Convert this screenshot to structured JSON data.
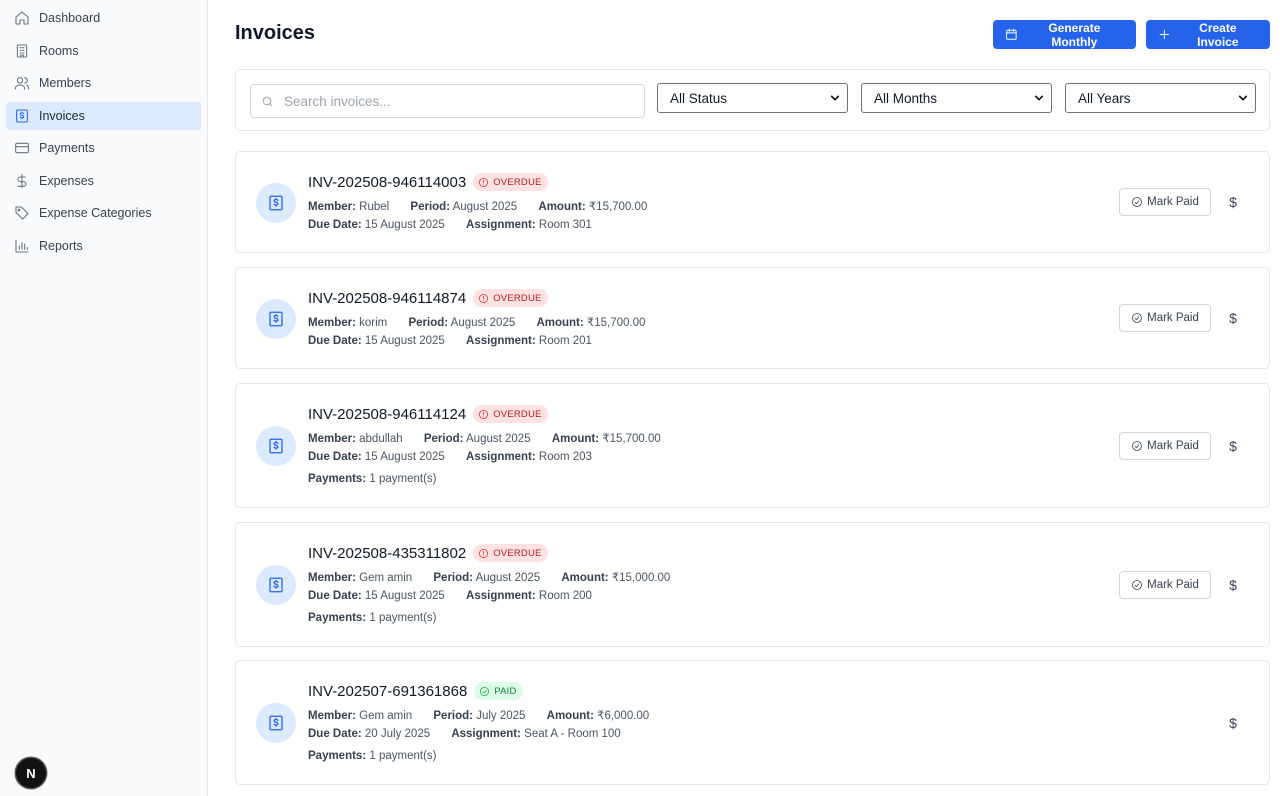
{
  "sidebar": {
    "items": [
      {
        "label": "Dashboard",
        "icon": "home-icon"
      },
      {
        "label": "Rooms",
        "icon": "building-icon"
      },
      {
        "label": "Members",
        "icon": "users-icon"
      },
      {
        "label": "Invoices",
        "icon": "receipt-icon",
        "active": true
      },
      {
        "label": "Payments",
        "icon": "credit-card-icon"
      },
      {
        "label": "Expenses",
        "icon": "dollar-icon"
      },
      {
        "label": "Expense Categories",
        "icon": "tag-icon"
      },
      {
        "label": "Reports",
        "icon": "bar-chart-icon"
      }
    ],
    "badge": "N"
  },
  "header": {
    "title": "Invoices",
    "generate_label": "Generate Monthly",
    "create_label": "Create Invoice"
  },
  "filters": {
    "search_placeholder": "Search invoices...",
    "status": "All Status",
    "months": "All Months",
    "years": "All Years"
  },
  "labels": {
    "member": "Member:",
    "period": "Period:",
    "amount": "Amount:",
    "due_date": "Due Date:",
    "assignment": "Assignment:",
    "payments": "Payments:",
    "mark_paid": "Mark Paid",
    "dollar": "$"
  },
  "invoices": [
    {
      "number": "INV-202508-946114003",
      "status": "OVERDUE",
      "member": "Rubel",
      "period": "August 2025",
      "amount": "₹15,700.00",
      "due_date": "15 August 2025",
      "assignment": "Room 301",
      "payments": ""
    },
    {
      "number": "INV-202508-946114874",
      "status": "OVERDUE",
      "member": "korim",
      "period": "August 2025",
      "amount": "₹15,700.00",
      "due_date": "15 August 2025",
      "assignment": "Room 201",
      "payments": ""
    },
    {
      "number": "INV-202508-946114124",
      "status": "OVERDUE",
      "member": "abdullah",
      "period": "August 2025",
      "amount": "₹15,700.00",
      "due_date": "15 August 2025",
      "assignment": "Room 203",
      "payments": "1 payment(s)"
    },
    {
      "number": "INV-202508-435311802",
      "status": "OVERDUE",
      "member": "Gem amin",
      "period": "August 2025",
      "amount": "₹15,000.00",
      "due_date": "15 August 2025",
      "assignment": "Room 200",
      "payments": "1 payment(s)"
    },
    {
      "number": "INV-202507-691361868",
      "status": "PAID",
      "member": "Gem amin",
      "period": "July 2025",
      "amount": "₹6,000.00",
      "due_date": "20 July 2025",
      "assignment": "Seat A - Room 100",
      "payments": "1 payment(s)"
    }
  ]
}
